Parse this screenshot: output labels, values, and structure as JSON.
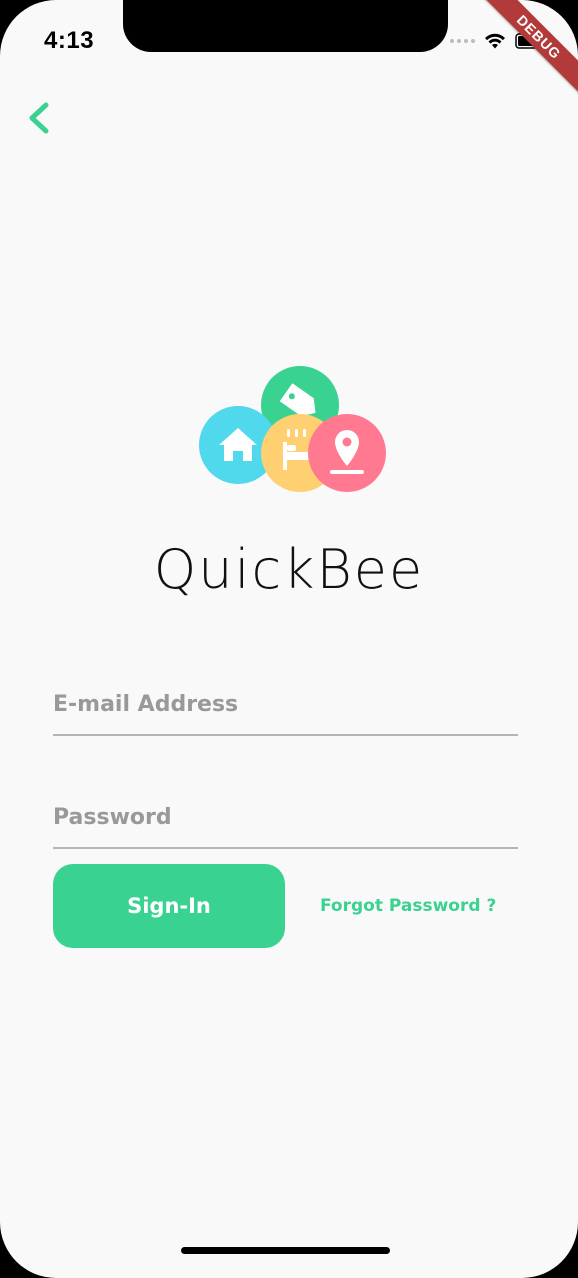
{
  "status_bar": {
    "time": "4:13"
  },
  "debug_banner": "DEBUG",
  "brand": {
    "name": "QuickBee"
  },
  "form": {
    "email_placeholder": "E-mail Address",
    "password_placeholder": "Password",
    "signin_label": "Sign-In",
    "forgot_label": "Forgot Password ?"
  },
  "colors": {
    "accent": "#3ad290",
    "logo_green": "#3ad290",
    "logo_cyan": "#50d8ec",
    "logo_yellow": "#ffd072",
    "logo_pink": "#ff7a90"
  },
  "icons": [
    "back-chevron-icon",
    "wifi-icon",
    "battery-icon",
    "tag-icon",
    "home-icon",
    "hotel-bed-icon",
    "location-pin-icon"
  ]
}
